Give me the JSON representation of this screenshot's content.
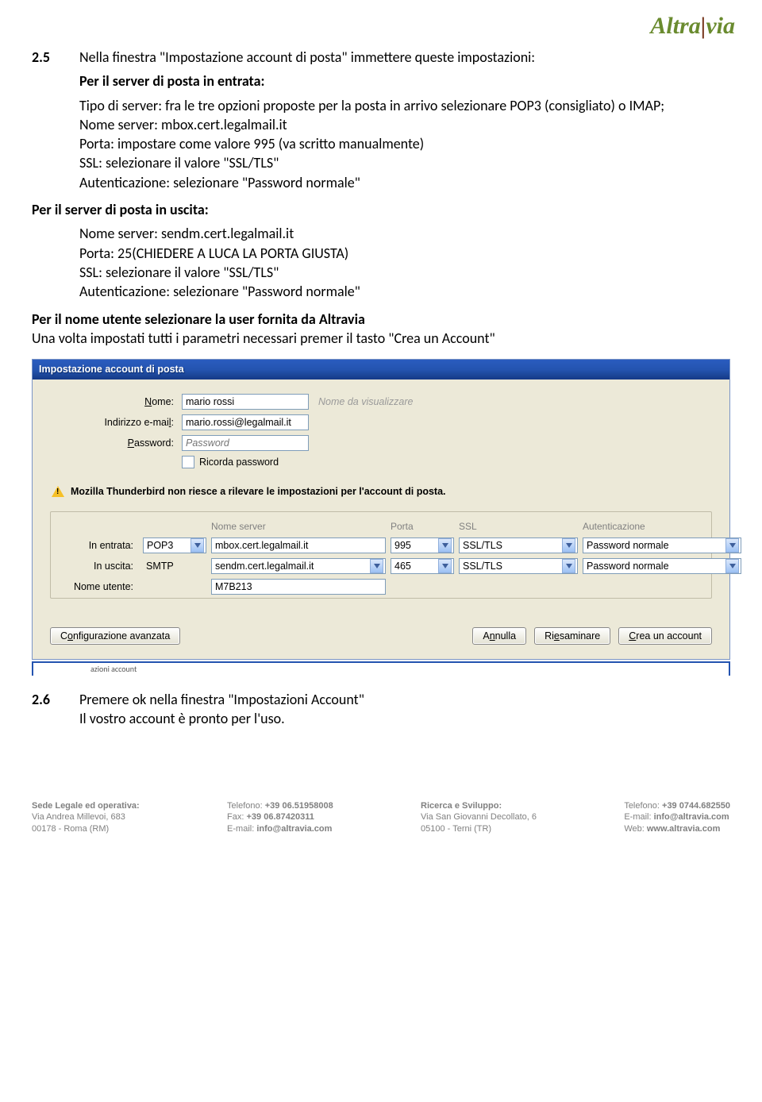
{
  "logo": {
    "word1": "Altra",
    "word2": "via"
  },
  "section25": {
    "num": "2.5",
    "title": "Nella finestra \"Impostazione account di posta\" immettere queste impostazioni:",
    "inLabel": "Per il server di posta in entrata:",
    "inLines": [
      "Tipo di server: fra le tre opzioni proposte per la posta in arrivo selezionare POP3 (consigliato) o IMAP;",
      "Nome server: mbox.cert.legalmail.it",
      "Porta: impostare come valore 995 (va scritto manualmente)",
      "SSL: selezionare il valore \"SSL/TLS\"",
      "Autenticazione: selezionare \"Password normale\""
    ],
    "outLabel": "Per il server di posta in uscita:",
    "outLines": [
      "Nome server: sendm.cert.legalmail.it",
      "Porta: 25(CHIEDERE A LUCA LA PORTA GIUSTA)",
      "SSL: selezionare il valore \"SSL/TLS\"",
      "Autenticazione: selezionare \"Password normale\""
    ],
    "userBold": "Per il nome utente selezionare la user fornita da Altravia",
    "userLine": "Una volta impostati tutti i parametri necessari premer il tasto  \"Crea un Account\""
  },
  "dialog": {
    "title": "Impostazione account di posta",
    "form": {
      "nomeLabel": "Nome:",
      "nomeValue": "mario rossi",
      "nomeGhost": "Nome da visualizzare",
      "emailLabel": "Indirizzo e-mail:",
      "emailValue": "mario.rossi@legalmail.it",
      "passLabel": "Password:",
      "passPlaceholder": "Password",
      "rememberLabel": "Ricorda password"
    },
    "warning": "Mozilla Thunderbird non riesce a rilevare le impostazioni per l'account di posta.",
    "grid": {
      "hServer": "Nome server",
      "hPort": "Porta",
      "hSSL": "SSL",
      "hAuth": "Autenticazione",
      "inLabel": "In entrata:",
      "inProto": "POP3",
      "inServer": "mbox.cert.legalmail.it",
      "inPort": "995",
      "inSSL": "SSL/TLS",
      "inAuth": "Password normale",
      "outLabel": "In uscita:",
      "outProto": "SMTP",
      "outServer": "sendm.cert.legalmail.it",
      "outPort": "465",
      "outSSL": "SSL/TLS",
      "outAuth": "Password normale",
      "userLabel": "Nome utente:",
      "userValue": "M7B213"
    },
    "buttons": {
      "advanced_pre": "C",
      "advanced_u": "o",
      "advanced_post": "nfigurazione avanzata",
      "cancel_pre": "A",
      "cancel_u": "n",
      "cancel_post": "nulla",
      "retest_pre": "Ri",
      "retest_u": "e",
      "retest_post": "saminare",
      "create_pre": "",
      "create_u": "C",
      "create_post": "rea un account"
    },
    "fragment": "azioni account"
  },
  "section26": {
    "num": "2.6",
    "line1": "Premere ok nella finestra \"Impostazioni Account\"",
    "line2": "Il vostro account è pronto per l'uso."
  },
  "footer": {
    "c1h": "Sede Legale ed operativa:",
    "c1a": "Via Andrea Millevoi, 683",
    "c1b": "00178 - Roma (RM)",
    "c2a_l": "Telefono: ",
    "c2a_v": "+39 06.51958008",
    "c2b_l": "Fax: ",
    "c2b_v": "+39 06.87420311",
    "c2c_l": "E-mail: ",
    "c2c_v": "info@altravia.com",
    "c3h": "Ricerca e Sviluppo:",
    "c3a": "Via San Giovanni Decollato, 6",
    "c3b": "05100 - Terni (TR)",
    "c4a_l": "Telefono: ",
    "c4a_v": "+39 0744.682550",
    "c4b_l": "E-mail: ",
    "c4b_v": "info@altravia.com",
    "c4c_l": "Web: ",
    "c4c_v": "www.altravia.com"
  }
}
